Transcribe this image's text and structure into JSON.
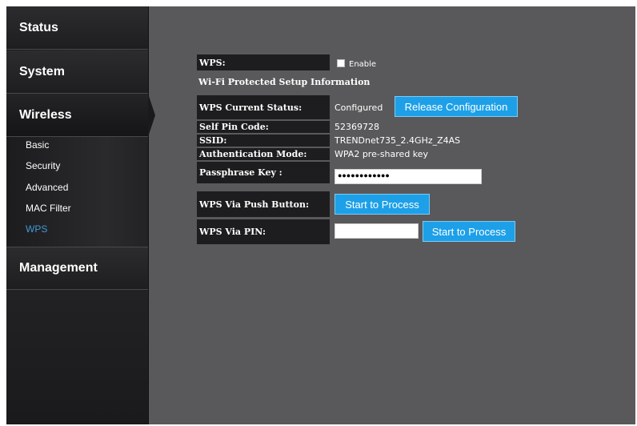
{
  "sidebar": {
    "status": "Status",
    "system": "System",
    "wireless": "Wireless",
    "wireless_items": [
      "Basic",
      "Security",
      "Advanced",
      "MAC Filter",
      "WPS"
    ],
    "management": "Management"
  },
  "wps": {
    "label": "WPS:",
    "enable_label": "Enable",
    "enable_checked": false,
    "section_title": "Wi-Fi Protected Setup Information",
    "current_status_label": "WPS Current Status:",
    "current_status_value": "Configured",
    "release_button": "Release Configuration",
    "self_pin_label": "Self Pin Code:",
    "self_pin_value": "52369728",
    "ssid_label": "SSID:",
    "ssid_value": "TRENDnet735_2.4GHz_Z4AS",
    "auth_label": "Authentication Mode:",
    "auth_value": "WPA2 pre-shared key",
    "passphrase_label": "Passphrase Key :",
    "passphrase_value": "●●●●●●●●●●●●",
    "push_button_label": "WPS Via Push Button:",
    "push_button": "Start to Process",
    "pin_label": "WPS Via PIN:",
    "pin_value": "",
    "pin_button": "Start to Process"
  },
  "colors": {
    "accent": "#1da0e8",
    "active_link": "#3f9ad6",
    "content_bg": "#59595b",
    "label_bg": "#1d1d1f"
  }
}
